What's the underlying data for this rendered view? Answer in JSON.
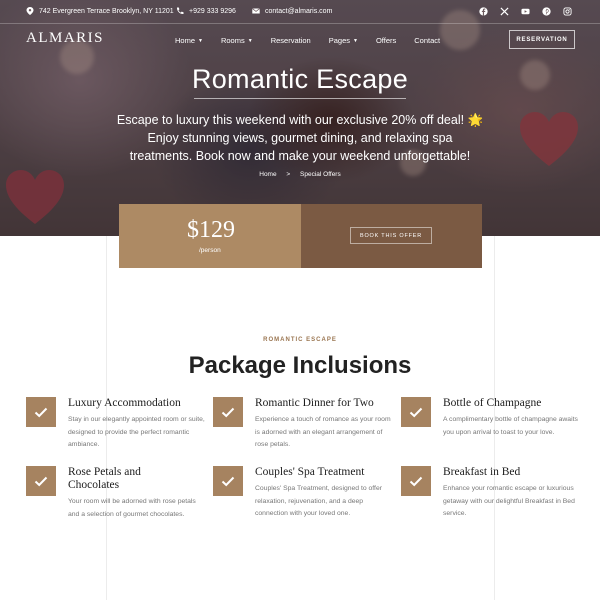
{
  "topbar": {
    "address": "742 Evergreen Terrace Brooklyn, NY 11201",
    "phone": "+929 333 9296",
    "email": "contact@almaris.com",
    "socials": [
      "facebook-icon",
      "x-icon",
      "youtube-icon",
      "pinterest-icon",
      "instagram-icon"
    ]
  },
  "header": {
    "logo": "ALMARIS",
    "nav": [
      {
        "label": "Home",
        "dropdown": true
      },
      {
        "label": "Rooms",
        "dropdown": true
      },
      {
        "label": "Reservation",
        "dropdown": false
      },
      {
        "label": "Pages",
        "dropdown": true
      },
      {
        "label": "Offers",
        "dropdown": false
      },
      {
        "label": "Contact",
        "dropdown": false
      }
    ],
    "reservation_button": "RESERVATION"
  },
  "hero": {
    "title": "Romantic Escape",
    "description": "Escape to luxury this weekend with our exclusive 20% off deal! 🌟 Enjoy stunning views, gourmet dining, and relaxing spa treatments. Book now and make your weekend unforgettable!",
    "breadcrumb": {
      "home": "Home",
      "separator": ">",
      "current": "Special Offers"
    }
  },
  "offer": {
    "price": "$129",
    "per": "/person",
    "book_button": "BOOK THIS OFFER"
  },
  "inclusions": {
    "eyebrow": "ROMANTIC ESCAPE",
    "title": "Package Inclusions",
    "items": [
      {
        "title": "Luxury Accommodation",
        "description": "Stay in our elegantly appointed room or suite, designed to provide the perfect romantic ambiance."
      },
      {
        "title": "Romantic Dinner for Two",
        "description": "Experience a touch of romance as your room is adorned with an elegant arrangement of rose petals."
      },
      {
        "title": "Bottle of Champagne",
        "description": "A complimentary bottle of champagne awaits you upon arrival to toast to your love."
      },
      {
        "title": "Rose Petals and Chocolates",
        "description": "Your room will be adorned with rose petals and a selection of gourmet chocolates."
      },
      {
        "title": "Couples' Spa Treatment",
        "description": "Couples' Spa Treatment, designed to offer relaxation, rejuvenation, and a deep connection with your loved one."
      },
      {
        "title": "Breakfast in Bed",
        "description": "Enhance your romantic escape or luxurious getaway with our delightful Breakfast in Bed service."
      }
    ]
  },
  "colors": {
    "accent": "#ad8a64",
    "accent_dark": "#7b5a43",
    "check_bg": "#a68360"
  }
}
